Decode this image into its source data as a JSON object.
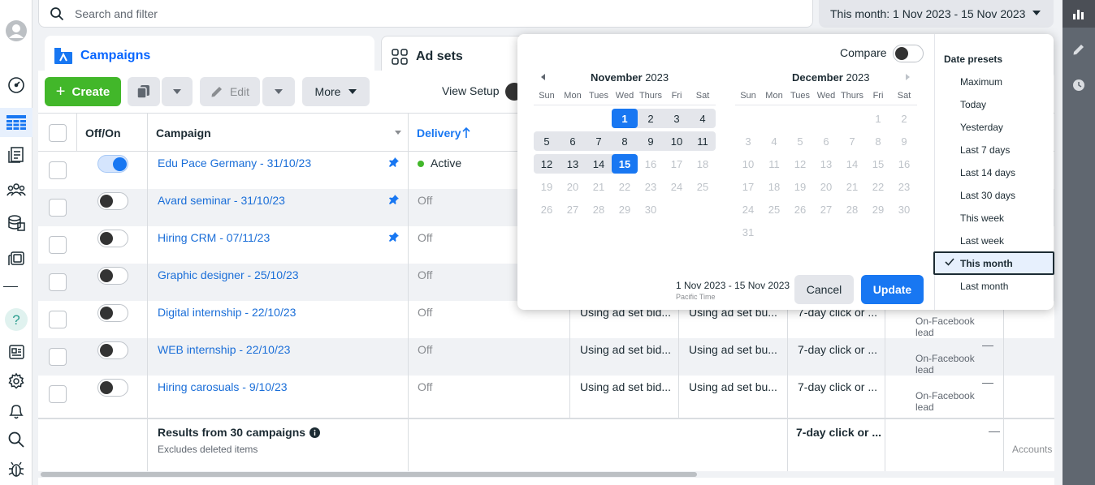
{
  "search": {
    "placeholder": "Search and filter"
  },
  "date_range_button": "This month: 1 Nov 2023 - 15 Nov 2023",
  "tabs": [
    {
      "label": "Campaigns"
    },
    {
      "label": "Ad sets"
    }
  ],
  "toolbar": {
    "create_label": "Create",
    "edit_label": "Edit",
    "more_label": "More",
    "view_setup_label": "View Setup"
  },
  "table": {
    "headers": {
      "off_on": "Off/On",
      "campaign": "Campaign",
      "delivery": "Delivery"
    },
    "rows": [
      {
        "on": true,
        "name": "Edu Pace Germany - 31/10/23",
        "pinned": true,
        "delivery": "Active",
        "bid": "",
        "budget": "",
        "attribution": "",
        "result_sub": ""
      },
      {
        "on": false,
        "name": "Avard seminar - 31/10/23",
        "pinned": true,
        "delivery": "Off",
        "bid": "",
        "budget": "",
        "attribution": "",
        "result_sub": ""
      },
      {
        "on": false,
        "name": "Hiring CRM - 07/11/23",
        "pinned": true,
        "delivery": "Off",
        "bid": "",
        "budget": "",
        "attribution": "",
        "result_sub": ""
      },
      {
        "on": false,
        "name": "Graphic designer - 25/10/23",
        "pinned": false,
        "delivery": "Off",
        "bid": "",
        "budget": "",
        "attribution": "",
        "result_sub": ""
      },
      {
        "on": false,
        "name": "Digital internship - 22/10/23",
        "pinned": false,
        "delivery": "Off",
        "bid": "Using ad set bid...",
        "budget": "Using ad set bu...",
        "attribution": "7-day click or ...",
        "result_sub": "On-Facebook lead"
      },
      {
        "on": false,
        "name": "WEB internship - 22/10/23",
        "pinned": false,
        "delivery": "Off",
        "bid": "Using ad set bid...",
        "budget": "Using ad set bu...",
        "attribution": "7-day click or ...",
        "result_sub": "On-Facebook lead"
      },
      {
        "on": false,
        "name": "Hiring carosuals - 9/10/23",
        "pinned": false,
        "delivery": "Off",
        "bid": "Using ad set bid...",
        "budget": "Using ad set bu...",
        "attribution": "7-day click or ...",
        "result_sub": "On-Facebook lead"
      }
    ],
    "dash": "—",
    "footer": {
      "title": "Results from 30 campaigns",
      "subtitle": "Excludes deleted items",
      "attribution": "7-day click or ...",
      "dash": "—",
      "accounts": "Accounts"
    }
  },
  "date_picker": {
    "compare_label": "Compare",
    "months": [
      {
        "name": "November",
        "year": "2023"
      },
      {
        "name": "December",
        "year": "2023"
      }
    ],
    "weekdays": [
      "Sun",
      "Mon",
      "Tues",
      "Wed",
      "Thurs",
      "Fri",
      "Sat"
    ],
    "range_text": "1 Nov 2023 - 15 Nov 2023",
    "timezone": "Pacific Time",
    "cancel_label": "Cancel",
    "update_label": "Update",
    "presets_title": "Date presets",
    "presets": [
      "Maximum",
      "Today",
      "Yesterday",
      "Last 7 days",
      "Last 14 days",
      "Last 30 days",
      "This week",
      "Last week",
      "This month",
      "Last month"
    ],
    "active_preset": "This month"
  }
}
